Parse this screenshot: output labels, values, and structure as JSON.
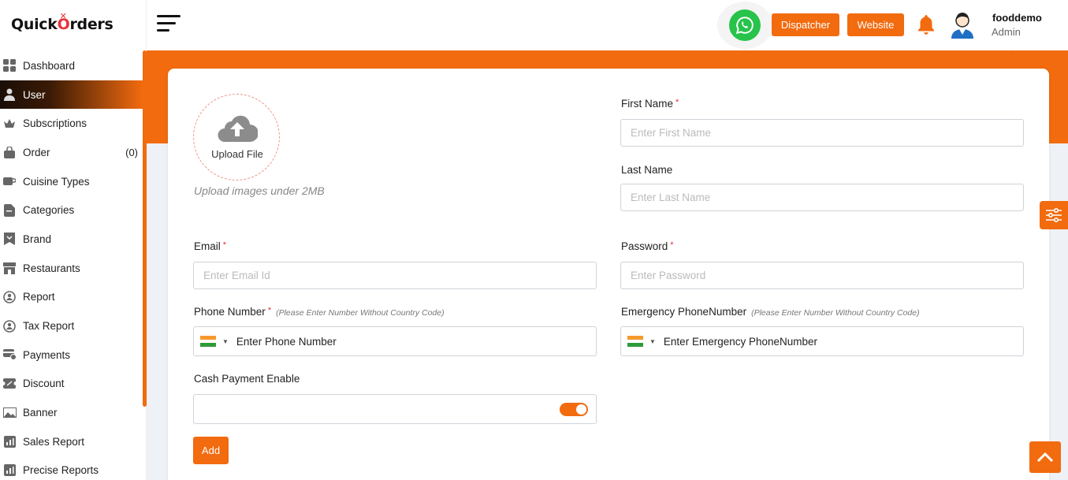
{
  "brand": {
    "name_left": "Quick",
    "name_o": "O",
    "name_right": "rders"
  },
  "sidebar": {
    "items": [
      {
        "label": "Dashboard",
        "icon": "dashboard-icon"
      },
      {
        "label": "User",
        "icon": "user-icon",
        "active": true
      },
      {
        "label": "Subscriptions",
        "icon": "crown-icon"
      },
      {
        "label": "Order",
        "icon": "bag-icon",
        "count": "(0)"
      },
      {
        "label": "Cuisine Types",
        "icon": "cup-icon"
      },
      {
        "label": "Categories",
        "icon": "categories-icon"
      },
      {
        "label": "Brand",
        "icon": "brand-icon"
      },
      {
        "label": "Restaurants",
        "icon": "store-icon"
      },
      {
        "label": "Report",
        "icon": "report-icon"
      },
      {
        "label": "Tax Report",
        "icon": "tax-report-icon"
      },
      {
        "label": "Payments",
        "icon": "payments-icon"
      },
      {
        "label": "Discount",
        "icon": "discount-icon"
      },
      {
        "label": "Banner",
        "icon": "banner-icon"
      },
      {
        "label": "Sales Report",
        "icon": "sales-report-icon"
      },
      {
        "label": "Precise Reports",
        "icon": "precise-reports-icon"
      }
    ]
  },
  "header": {
    "dispatcher_label": "Dispatcher",
    "website_label": "Website",
    "user_name": "fooddemo",
    "user_role": "Admin"
  },
  "form": {
    "upload_label": "Upload File",
    "upload_hint": "Upload images under 2MB",
    "first_name": {
      "label": "First Name",
      "required": "*",
      "placeholder": "Enter First Name"
    },
    "last_name": {
      "label": "Last Name",
      "placeholder": "Enter Last Name"
    },
    "email": {
      "label": "Email",
      "required": "*",
      "placeholder": "Enter Email Id"
    },
    "password": {
      "label": "Password",
      "required": "*",
      "placeholder": "Enter Password"
    },
    "phone": {
      "label": "Phone Number",
      "required": "*",
      "note": "(Please Enter Number Without Country Code)",
      "placeholder": "Enter Phone Number"
    },
    "emergency_phone": {
      "label": "Emergency PhoneNumber",
      "note": "(Please Enter Number Without Country Code)",
      "placeholder": "Enter Emergency PhoneNumber"
    },
    "cash_payment": {
      "label": "Cash Payment Enable",
      "enabled": true
    },
    "add_label": "Add"
  },
  "colors": {
    "accent": "#f26b0f",
    "required": "#e8323b",
    "whatsapp": "#27c34a"
  }
}
